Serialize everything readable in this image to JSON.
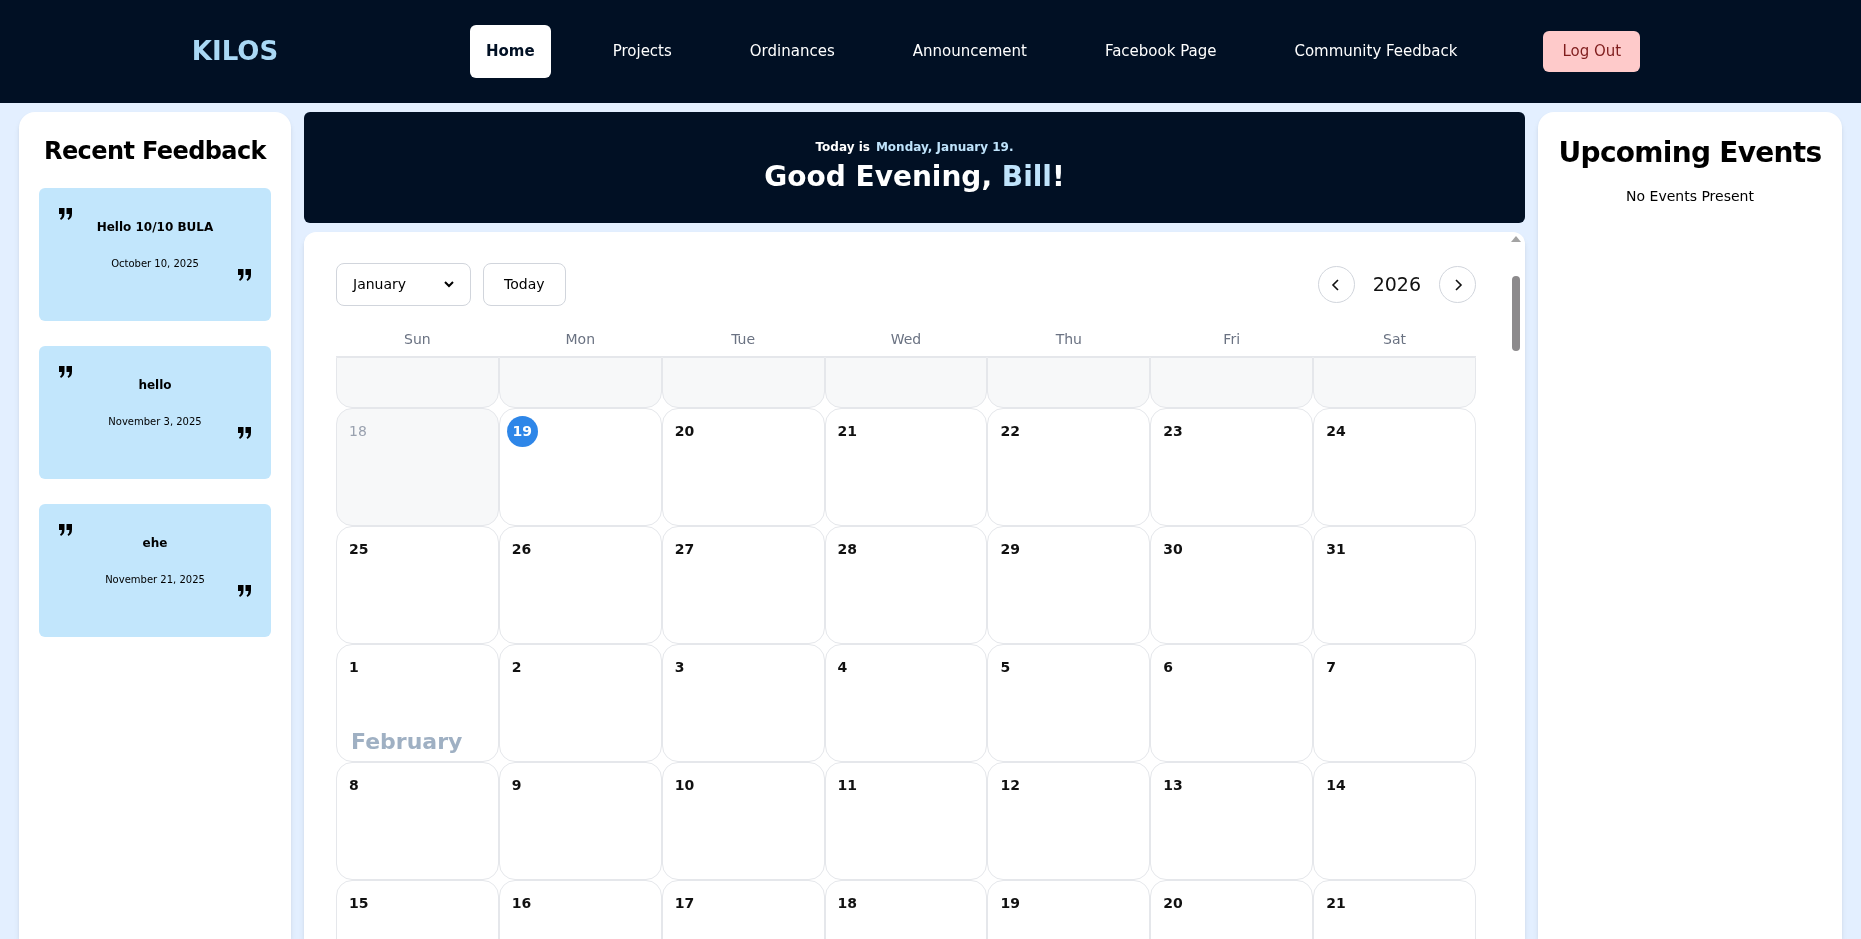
{
  "nav": {
    "logo": "KILOS",
    "links": [
      {
        "label": "Home",
        "selected": true
      },
      {
        "label": "Projects",
        "selected": false
      },
      {
        "label": "Ordinances",
        "selected": false
      },
      {
        "label": "Announcement",
        "selected": false
      },
      {
        "label": "Facebook Page",
        "selected": false
      },
      {
        "label": "Community Feedback",
        "selected": false
      }
    ],
    "logout": "Log Out"
  },
  "recent_feedback": {
    "title": "Recent Feedback",
    "items": [
      {
        "text": "Hello 10/10 BULA",
        "date": "October 10, 2025"
      },
      {
        "text": "hello",
        "date": "November 3, 2025"
      },
      {
        "text": "ehe",
        "date": "November 21, 2025"
      }
    ]
  },
  "greeting": {
    "today_label": "Today is",
    "today_date": "Monday, January 19.",
    "salutation": "Good Evening,",
    "name": "Bill",
    "punctuation": "!"
  },
  "calendar": {
    "month_select": "January",
    "today_button": "Today",
    "year": "2026",
    "weekdays": [
      "Sun",
      "Mon",
      "Tue",
      "Wed",
      "Thu",
      "Fri",
      "Sat"
    ],
    "weeks": [
      {
        "days": [
          {
            "kind": "blank"
          },
          {
            "kind": "blank"
          },
          {
            "kind": "blank"
          },
          {
            "kind": "blank"
          },
          {
            "kind": "blank"
          },
          {
            "kind": "blank"
          },
          {
            "kind": "blank"
          }
        ]
      },
      {
        "days": [
          {
            "kind": "past",
            "label": "18"
          },
          {
            "kind": "today",
            "label": "19"
          },
          {
            "kind": "day",
            "label": "20"
          },
          {
            "kind": "day",
            "label": "21"
          },
          {
            "kind": "day",
            "label": "22"
          },
          {
            "kind": "day",
            "label": "23"
          },
          {
            "kind": "day",
            "label": "24"
          }
        ]
      },
      {
        "days": [
          {
            "kind": "day",
            "label": "25"
          },
          {
            "kind": "day",
            "label": "26"
          },
          {
            "kind": "day",
            "label": "27"
          },
          {
            "kind": "day",
            "label": "28"
          },
          {
            "kind": "day",
            "label": "29"
          },
          {
            "kind": "day",
            "label": "30"
          },
          {
            "kind": "day",
            "label": "31"
          }
        ]
      },
      {
        "month_label": "February",
        "days": [
          {
            "kind": "day",
            "label": "1"
          },
          {
            "kind": "day",
            "label": "2"
          },
          {
            "kind": "day",
            "label": "3"
          },
          {
            "kind": "day",
            "label": "4"
          },
          {
            "kind": "day",
            "label": "5"
          },
          {
            "kind": "day",
            "label": "6"
          },
          {
            "kind": "day",
            "label": "7"
          }
        ]
      },
      {
        "days": [
          {
            "kind": "day",
            "label": "8"
          },
          {
            "kind": "day",
            "label": "9"
          },
          {
            "kind": "day",
            "label": "10"
          },
          {
            "kind": "day",
            "label": "11"
          },
          {
            "kind": "day",
            "label": "12"
          },
          {
            "kind": "day",
            "label": "13"
          },
          {
            "kind": "day",
            "label": "14"
          }
        ]
      },
      {
        "days": [
          {
            "kind": "day",
            "label": "15"
          },
          {
            "kind": "day",
            "label": "16"
          },
          {
            "kind": "day",
            "label": "17"
          },
          {
            "kind": "day",
            "label": "18"
          },
          {
            "kind": "day",
            "label": "19"
          },
          {
            "kind": "day",
            "label": "20"
          },
          {
            "kind": "day",
            "label": "21"
          }
        ]
      }
    ]
  },
  "upcoming_events": {
    "title": "Upcoming Events",
    "empty_message": "No Events Present"
  }
}
